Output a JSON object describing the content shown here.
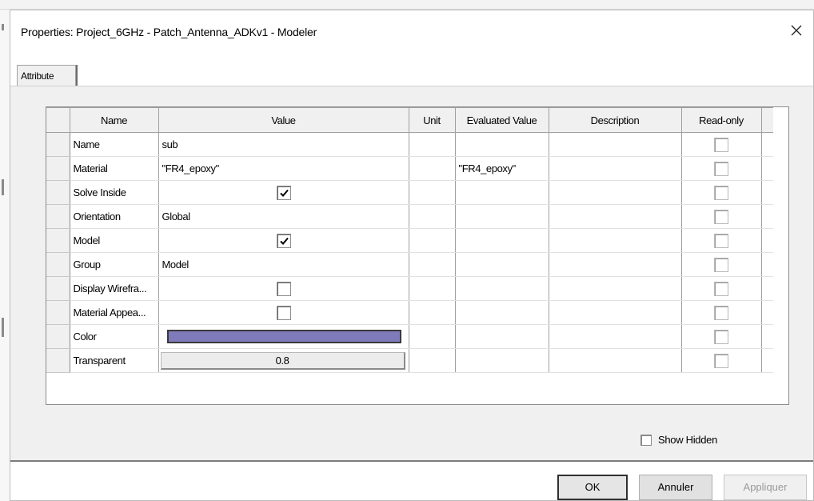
{
  "window": {
    "title": "Properties: Project_6GHz - Patch_Antenna_ADKv1 - Modeler"
  },
  "tabs": [
    {
      "label": "Attribute",
      "active": true
    }
  ],
  "table": {
    "columns": {
      "name": "Name",
      "value": "Value",
      "unit": "Unit",
      "evaluated": "Evaluated Value",
      "description": "Description",
      "readonly": "Read-only"
    },
    "rows": [
      {
        "name": "Name",
        "value": "sub",
        "evaluated": ""
      },
      {
        "name": "Material",
        "value": "\"FR4_epoxy\"",
        "evaluated": "\"FR4_epoxy\""
      },
      {
        "name": "Solve Inside",
        "value_checkbox": true
      },
      {
        "name": "Orientation",
        "value": "Global"
      },
      {
        "name": "Model",
        "value_checkbox": true
      },
      {
        "name": "Group",
        "value": "Model"
      },
      {
        "name": "Display Wirefra...",
        "value_checkbox": false
      },
      {
        "name": "Material Appea...",
        "value_checkbox": false
      },
      {
        "name": "Color",
        "value_color": "#7f7bbb"
      },
      {
        "name": "Transparent",
        "value": "0.8"
      }
    ]
  },
  "show_hidden": {
    "label": "Show Hidden",
    "checked": false
  },
  "buttons": {
    "ok": "OK",
    "cancel": "Annuler",
    "apply": "Appliquer"
  },
  "colors": {
    "swatch": "#7f7bbb",
    "panel": "#f0f0f0"
  },
  "icons": [
    "close-icon",
    "check-icon"
  ]
}
